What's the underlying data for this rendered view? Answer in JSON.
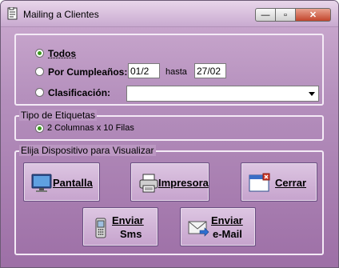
{
  "window": {
    "title": "Mailing a Clientes",
    "minimize_symbol": "—",
    "maximize_symbol": "▫",
    "close_symbol": "✕"
  },
  "filters": {
    "todos_label": "Todos",
    "cumple_label": "Por Cumpleaños:",
    "cumple_from": "01/2",
    "hasta_label": "hasta",
    "cumple_to": "27/02",
    "clasif_label": "Clasificación:",
    "clasif_value": "",
    "selected": "todos"
  },
  "tipo_etiquetas": {
    "title": "Tipo de Etiquetas",
    "option_label": "2 Columnas x 10 Filas"
  },
  "dispositivo": {
    "title": "Elija Dispositivo para Visualizar",
    "pantalla": "Pantalla",
    "impresora": "Impresora",
    "cerrar": "Cerrar",
    "sms_line1": "Enviar",
    "sms_line2": "Sms",
    "email_line1": "Enviar",
    "email_line2": "e-Mail"
  },
  "icons": {
    "app": "document-icon",
    "pantalla": "monitor-icon",
    "impresora": "printer-icon",
    "cerrar": "close-window-icon",
    "sms": "phone-icon",
    "email": "envelope-icon"
  },
  "colors": {
    "background": "#b590bd",
    "radio_selected": "#3c9a1e",
    "close_button": "#c3452c"
  }
}
